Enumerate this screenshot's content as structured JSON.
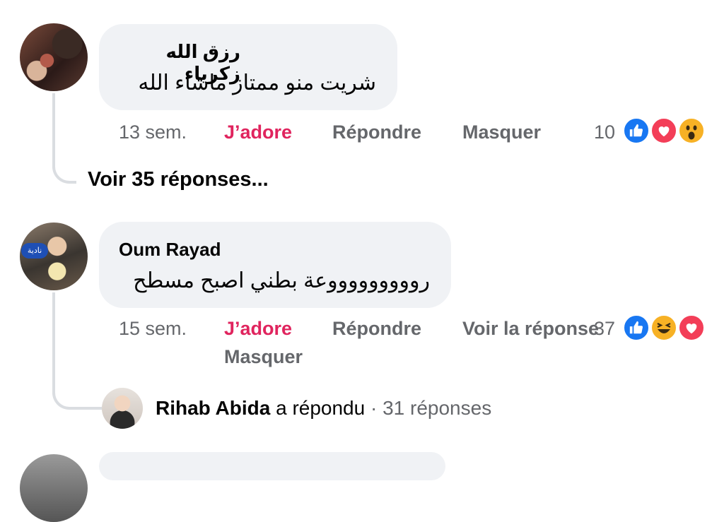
{
  "comments": [
    {
      "author": "رزق الله زكرياء",
      "text": "شريت منو ممتاز ماشاء الله",
      "time": "13 sem.",
      "like_label": "J’adore",
      "reply_label": "Répondre",
      "hide_label": "Masquer",
      "reaction_count": "10",
      "reactions": [
        "like-icon",
        "love-icon",
        "wow-icon"
      ]
    },
    {
      "author": "Oum Rayad",
      "avatar_badge": "نادية",
      "text": "روووووووووعة بطني اصبح مسطح",
      "time": "15 sem.",
      "like_label": "J’adore",
      "reply_label": "Répondre",
      "view_reply_label": "Voir la réponse",
      "hide_label": "Masquer",
      "reaction_count": "37",
      "reactions": [
        "like-icon",
        "haha-icon",
        "love-icon"
      ]
    }
  ],
  "view_replies_link": "Voir 35 réponses...",
  "reply_summary": {
    "name": "Rihab Abida",
    "action": "a répondu",
    "separator": "·",
    "count": "31 réponses"
  },
  "colors": {
    "bubble": "#f0f2f5",
    "like_text": "#e0245e",
    "secondary_text": "#65676b",
    "thread_line": "#dadde1"
  }
}
